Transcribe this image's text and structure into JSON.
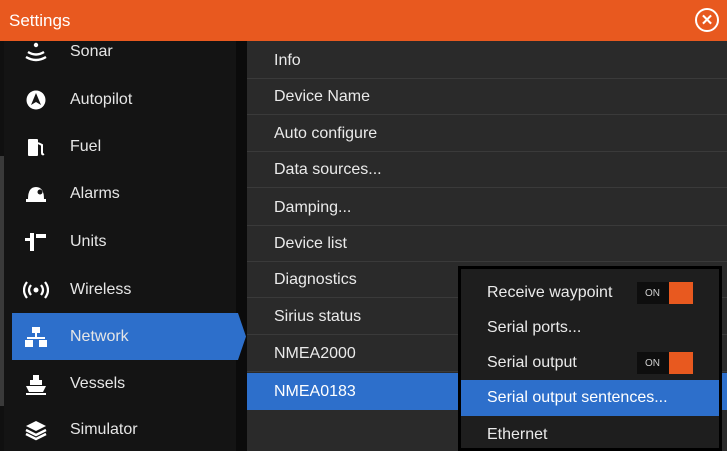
{
  "window": {
    "title": "Settings",
    "close_icon": "close-icon",
    "accent": "#e8591f",
    "selection": "#2d6fcb"
  },
  "sidebar": {
    "items": [
      {
        "label": "Sonar",
        "icon": "sonar-icon"
      },
      {
        "label": "Autopilot",
        "icon": "autopilot-icon"
      },
      {
        "label": "Fuel",
        "icon": "fuel-icon"
      },
      {
        "label": "Alarms",
        "icon": "alarm-icon"
      },
      {
        "label": "Units",
        "icon": "units-icon"
      },
      {
        "label": "Wireless",
        "icon": "wireless-icon"
      },
      {
        "label": "Network",
        "icon": "network-icon",
        "selected": true
      },
      {
        "label": "Vessels",
        "icon": "vessels-icon"
      },
      {
        "label": "Simulator",
        "icon": "simulator-icon"
      }
    ]
  },
  "network_menu": {
    "items": [
      {
        "label": "Info"
      },
      {
        "label": "Device Name"
      },
      {
        "label": "Auto configure"
      },
      {
        "label": "Data sources..."
      },
      {
        "label": "Damping..."
      },
      {
        "label": "Device list"
      },
      {
        "label": "Diagnostics"
      },
      {
        "label": "Sirius status"
      },
      {
        "label": "NMEA2000"
      },
      {
        "label": "NMEA0183",
        "selected": true
      }
    ]
  },
  "nmea0183_menu": {
    "items": [
      {
        "label": "Receive waypoint",
        "toggle": "ON"
      },
      {
        "label": "Serial ports..."
      },
      {
        "label": "Serial output",
        "toggle": "ON"
      },
      {
        "label": "Serial output sentences...",
        "selected": true
      },
      {
        "label": "Ethernet"
      }
    ]
  }
}
